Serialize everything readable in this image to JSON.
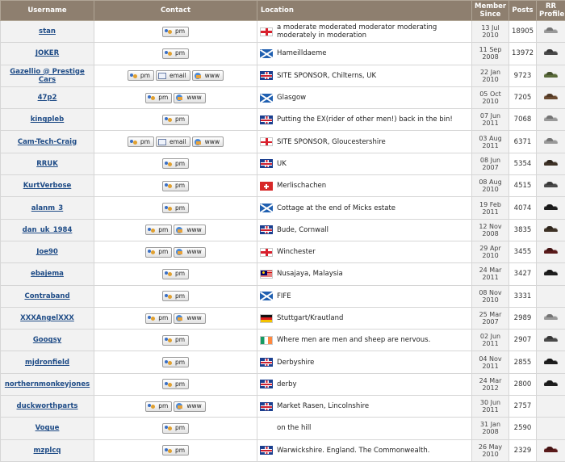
{
  "headers": {
    "username": "Username",
    "contact": "Contact",
    "location": "Location",
    "member_since": "Member Since",
    "posts": "Posts",
    "rr_profile": "RR Profile"
  },
  "buttons": {
    "pm": "pm",
    "email": "email",
    "www": "www"
  },
  "rows": [
    {
      "username": "stan",
      "contact": [
        "pm"
      ],
      "flag": "england",
      "location": "a moderate moderated moderator moderating moderately in moderation",
      "since_date": "13 Jul",
      "since_year": "2010",
      "posts": "18905",
      "rr_car": "silver"
    },
    {
      "username": "JOKER",
      "contact": [
        "pm"
      ],
      "flag": "scotland",
      "location": "Hameilldaeme",
      "since_date": "11 Sep",
      "since_year": "2008",
      "posts": "13972",
      "rr_car": "dark-grey"
    },
    {
      "username": "Gazellio @ Prestige Cars",
      "contact": [
        "pm",
        "email",
        "www"
      ],
      "flag": "uk",
      "location": "SITE SPONSOR, Chilterns, UK",
      "since_date": "22 Jan",
      "since_year": "2010",
      "posts": "9723",
      "rr_car": "green"
    },
    {
      "username": "47p2",
      "contact": [
        "pm",
        "www"
      ],
      "flag": "scotland",
      "location": "Glasgow",
      "since_date": "05 Oct",
      "since_year": "2010",
      "posts": "7205",
      "rr_car": "brown"
    },
    {
      "username": "kingpleb",
      "contact": [
        "pm"
      ],
      "flag": "uk",
      "location": "Putting the EX(rider of other men!) back in the bin!",
      "since_date": "07 Jun",
      "since_year": "2011",
      "posts": "7068",
      "rr_car": "silver"
    },
    {
      "username": "Cam-Tech-Craig",
      "contact": [
        "pm",
        "email",
        "www"
      ],
      "flag": "england",
      "location": "SITE SPONSOR, Gloucestershire",
      "since_date": "03 Aug",
      "since_year": "2011",
      "posts": "6371",
      "rr_car": "silver"
    },
    {
      "username": "RRUK",
      "contact": [
        "pm"
      ],
      "flag": "uk",
      "location": "UK",
      "since_date": "08 Jun",
      "since_year": "2007",
      "posts": "5354",
      "rr_car": "dark-brown"
    },
    {
      "username": "KurtVerbose",
      "contact": [
        "pm"
      ],
      "flag": "switzerland",
      "location": "Merlischachen",
      "since_date": "08 Aug",
      "since_year": "2010",
      "posts": "4515",
      "rr_car": "dark-grey"
    },
    {
      "username": "alanm_3",
      "contact": [
        "pm"
      ],
      "flag": "scotland",
      "location": "Cottage at the end of Micks estate",
      "since_date": "19 Feb",
      "since_year": "2011",
      "posts": "4074",
      "rr_car": "black"
    },
    {
      "username": "dan_uk_1984",
      "contact": [
        "pm",
        "www"
      ],
      "flag": "uk",
      "location": "Bude, Cornwall",
      "since_date": "12 Nov",
      "since_year": "2008",
      "posts": "3835",
      "rr_car": "dark-brown"
    },
    {
      "username": "Joe90",
      "contact": [
        "pm",
        "www"
      ],
      "flag": "england",
      "location": "Winchester",
      "since_date": "29 Apr",
      "since_year": "2010",
      "posts": "3455",
      "rr_car": "maroon"
    },
    {
      "username": "ebajema",
      "contact": [
        "pm"
      ],
      "flag": "malaysia",
      "location": "Nusajaya, Malaysia",
      "since_date": "24 Mar",
      "since_year": "2011",
      "posts": "3427",
      "rr_car": "black"
    },
    {
      "username": "Contraband",
      "contact": [
        "pm"
      ],
      "flag": "scotland",
      "location": "FIFE",
      "since_date": "08 Nov",
      "since_year": "2010",
      "posts": "3331",
      "rr_car": ""
    },
    {
      "username": "XXXAngelXXX",
      "contact": [
        "pm",
        "www"
      ],
      "flag": "germany",
      "location": "Stuttgart/Krautland",
      "since_date": "25 Mar",
      "since_year": "2007",
      "posts": "2989",
      "rr_car": "silver"
    },
    {
      "username": "Googsy",
      "contact": [
        "pm"
      ],
      "flag": "ireland",
      "location": "Where men are men and sheep are nervous.",
      "since_date": "02 Jun",
      "since_year": "2011",
      "posts": "2907",
      "rr_car": "dark-grey"
    },
    {
      "username": "mjdronfield",
      "contact": [
        "pm"
      ],
      "flag": "uk",
      "location": "Derbyshire",
      "since_date": "04 Nov",
      "since_year": "2011",
      "posts": "2855",
      "rr_car": "black"
    },
    {
      "username": "northernmonkeyjones",
      "contact": [
        "pm"
      ],
      "flag": "uk",
      "location": "derby",
      "since_date": "24 Mar",
      "since_year": "2012",
      "posts": "2800",
      "rr_car": "black"
    },
    {
      "username": "duckworthparts",
      "contact": [
        "pm",
        "www"
      ],
      "flag": "uk",
      "location": "Market Rasen, Lincolnshire",
      "since_date": "30 Jun",
      "since_year": "2011",
      "posts": "2757",
      "rr_car": ""
    },
    {
      "username": "Vogue",
      "contact": [
        "pm"
      ],
      "flag": "",
      "location": "on the hill",
      "since_date": "31 Jan",
      "since_year": "2008",
      "posts": "2590",
      "rr_car": ""
    },
    {
      "username": "mzplcq",
      "contact": [
        "pm"
      ],
      "flag": "uk",
      "location": "Warwickshire. England. The Commonwealth.",
      "since_date": "26 May",
      "since_year": "2010",
      "posts": "2329",
      "rr_car": "maroon"
    }
  ],
  "colors": {
    "header_bg": "#8e7f6f",
    "link": "#1e4b86",
    "car_silver": "#9a9a9a",
    "car_dark-grey": "#4a4a4a",
    "car_green": "#5a6b3a",
    "car_brown": "#6a4a30",
    "car_dark-brown": "#3e3226",
    "car_black": "#1e1e1e",
    "car_maroon": "#5a1a1a"
  }
}
